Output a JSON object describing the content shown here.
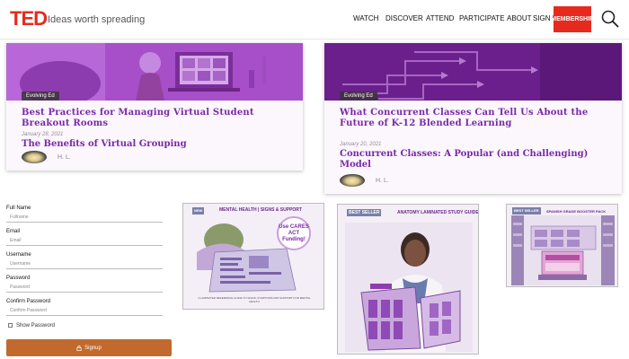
{
  "header": {
    "logo": "TED",
    "tagline": "Ideas worth spreading",
    "nav": [
      "WATCH",
      "DISCOVER",
      "ATTEND",
      "PARTICIPATE",
      "ABOUT"
    ],
    "sign_in": "SIGN IN",
    "membership": "MEMBERSHIP"
  },
  "articles": [
    {
      "tag": "Evolving Ed",
      "title": "Best Practices for Managing Virtual Student Breakout Rooms",
      "date": "January 28, 2021",
      "subtitle": "The Benefits of Virtual Grouping",
      "author": "H. L."
    },
    {
      "tag": "Evolving Ed",
      "title": "What Concurrent Classes Can Tell Us About the Future of K-12 Blended Learning",
      "date": "January 20, 2021",
      "subtitle": "Concurrent Classes: A Popular (and Challenging) Model",
      "author": "H. L."
    }
  ],
  "form": {
    "full_name_label": "Full Name",
    "full_name_placeholder": "Fullname",
    "email_label": "Email",
    "email_placeholder": "Email",
    "username_label": "Username",
    "username_placeholder": "Username",
    "password_label": "Password",
    "password_placeholder": "Password",
    "confirm_label": "Confirm Password",
    "confirm_placeholder": "Confirm Password",
    "show_password": "Show Password",
    "signup": "Signup"
  },
  "ads": [
    {
      "badge": "NEW",
      "title": "MENTAL HEALTH | SIGNS & SUPPORT",
      "callout": "Use CARES ACT Funding!",
      "note": "A LAMINATED REFERENCE GUIDE TO SIGNS, SYMPTOMS AND SUPPORT FOR MENTAL HEALTH"
    },
    {
      "badge": "BEST SELLER",
      "title": "ANATOMY LAMINATED STUDY GUIDE"
    },
    {
      "badge": "BEST SELLER",
      "title": "SPANISH GRADE BOOSTER PACK"
    }
  ],
  "colors": {
    "ted_red": "#e62b1e",
    "purple": "#7a28a8",
    "signup": "#c26a2e"
  }
}
